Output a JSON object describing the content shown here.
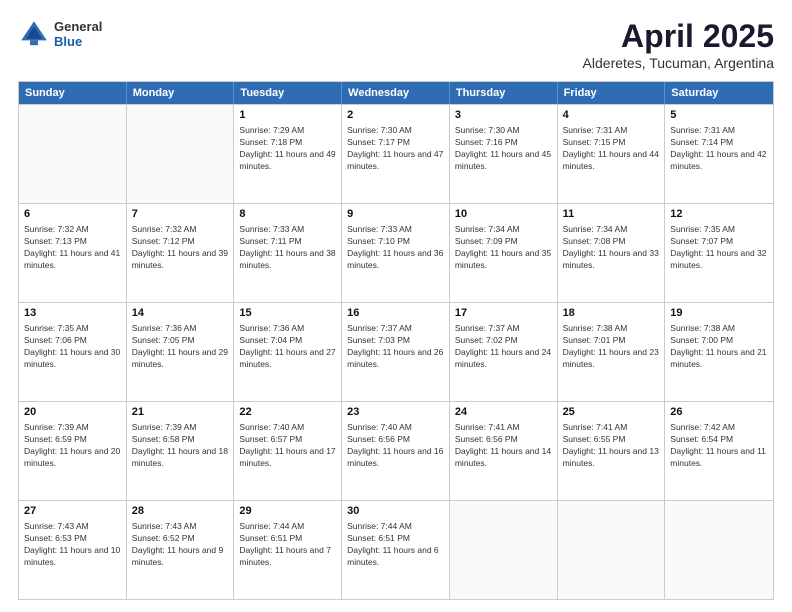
{
  "header": {
    "logo": {
      "general": "General",
      "blue": "Blue"
    },
    "title": "April 2025",
    "subtitle": "Alderetes, Tucuman, Argentina"
  },
  "weekdays": [
    "Sunday",
    "Monday",
    "Tuesday",
    "Wednesday",
    "Thursday",
    "Friday",
    "Saturday"
  ],
  "rows": [
    [
      {
        "day": "",
        "sunrise": "",
        "sunset": "",
        "daylight": ""
      },
      {
        "day": "",
        "sunrise": "",
        "sunset": "",
        "daylight": ""
      },
      {
        "day": "1",
        "sunrise": "Sunrise: 7:29 AM",
        "sunset": "Sunset: 7:18 PM",
        "daylight": "Daylight: 11 hours and 49 minutes."
      },
      {
        "day": "2",
        "sunrise": "Sunrise: 7:30 AM",
        "sunset": "Sunset: 7:17 PM",
        "daylight": "Daylight: 11 hours and 47 minutes."
      },
      {
        "day": "3",
        "sunrise": "Sunrise: 7:30 AM",
        "sunset": "Sunset: 7:16 PM",
        "daylight": "Daylight: 11 hours and 45 minutes."
      },
      {
        "day": "4",
        "sunrise": "Sunrise: 7:31 AM",
        "sunset": "Sunset: 7:15 PM",
        "daylight": "Daylight: 11 hours and 44 minutes."
      },
      {
        "day": "5",
        "sunrise": "Sunrise: 7:31 AM",
        "sunset": "Sunset: 7:14 PM",
        "daylight": "Daylight: 11 hours and 42 minutes."
      }
    ],
    [
      {
        "day": "6",
        "sunrise": "Sunrise: 7:32 AM",
        "sunset": "Sunset: 7:13 PM",
        "daylight": "Daylight: 11 hours and 41 minutes."
      },
      {
        "day": "7",
        "sunrise": "Sunrise: 7:32 AM",
        "sunset": "Sunset: 7:12 PM",
        "daylight": "Daylight: 11 hours and 39 minutes."
      },
      {
        "day": "8",
        "sunrise": "Sunrise: 7:33 AM",
        "sunset": "Sunset: 7:11 PM",
        "daylight": "Daylight: 11 hours and 38 minutes."
      },
      {
        "day": "9",
        "sunrise": "Sunrise: 7:33 AM",
        "sunset": "Sunset: 7:10 PM",
        "daylight": "Daylight: 11 hours and 36 minutes."
      },
      {
        "day": "10",
        "sunrise": "Sunrise: 7:34 AM",
        "sunset": "Sunset: 7:09 PM",
        "daylight": "Daylight: 11 hours and 35 minutes."
      },
      {
        "day": "11",
        "sunrise": "Sunrise: 7:34 AM",
        "sunset": "Sunset: 7:08 PM",
        "daylight": "Daylight: 11 hours and 33 minutes."
      },
      {
        "day": "12",
        "sunrise": "Sunrise: 7:35 AM",
        "sunset": "Sunset: 7:07 PM",
        "daylight": "Daylight: 11 hours and 32 minutes."
      }
    ],
    [
      {
        "day": "13",
        "sunrise": "Sunrise: 7:35 AM",
        "sunset": "Sunset: 7:06 PM",
        "daylight": "Daylight: 11 hours and 30 minutes."
      },
      {
        "day": "14",
        "sunrise": "Sunrise: 7:36 AM",
        "sunset": "Sunset: 7:05 PM",
        "daylight": "Daylight: 11 hours and 29 minutes."
      },
      {
        "day": "15",
        "sunrise": "Sunrise: 7:36 AM",
        "sunset": "Sunset: 7:04 PM",
        "daylight": "Daylight: 11 hours and 27 minutes."
      },
      {
        "day": "16",
        "sunrise": "Sunrise: 7:37 AM",
        "sunset": "Sunset: 7:03 PM",
        "daylight": "Daylight: 11 hours and 26 minutes."
      },
      {
        "day": "17",
        "sunrise": "Sunrise: 7:37 AM",
        "sunset": "Sunset: 7:02 PM",
        "daylight": "Daylight: 11 hours and 24 minutes."
      },
      {
        "day": "18",
        "sunrise": "Sunrise: 7:38 AM",
        "sunset": "Sunset: 7:01 PM",
        "daylight": "Daylight: 11 hours and 23 minutes."
      },
      {
        "day": "19",
        "sunrise": "Sunrise: 7:38 AM",
        "sunset": "Sunset: 7:00 PM",
        "daylight": "Daylight: 11 hours and 21 minutes."
      }
    ],
    [
      {
        "day": "20",
        "sunrise": "Sunrise: 7:39 AM",
        "sunset": "Sunset: 6:59 PM",
        "daylight": "Daylight: 11 hours and 20 minutes."
      },
      {
        "day": "21",
        "sunrise": "Sunrise: 7:39 AM",
        "sunset": "Sunset: 6:58 PM",
        "daylight": "Daylight: 11 hours and 18 minutes."
      },
      {
        "day": "22",
        "sunrise": "Sunrise: 7:40 AM",
        "sunset": "Sunset: 6:57 PM",
        "daylight": "Daylight: 11 hours and 17 minutes."
      },
      {
        "day": "23",
        "sunrise": "Sunrise: 7:40 AM",
        "sunset": "Sunset: 6:56 PM",
        "daylight": "Daylight: 11 hours and 16 minutes."
      },
      {
        "day": "24",
        "sunrise": "Sunrise: 7:41 AM",
        "sunset": "Sunset: 6:56 PM",
        "daylight": "Daylight: 11 hours and 14 minutes."
      },
      {
        "day": "25",
        "sunrise": "Sunrise: 7:41 AM",
        "sunset": "Sunset: 6:55 PM",
        "daylight": "Daylight: 11 hours and 13 minutes."
      },
      {
        "day": "26",
        "sunrise": "Sunrise: 7:42 AM",
        "sunset": "Sunset: 6:54 PM",
        "daylight": "Daylight: 11 hours and 11 minutes."
      }
    ],
    [
      {
        "day": "27",
        "sunrise": "Sunrise: 7:43 AM",
        "sunset": "Sunset: 6:53 PM",
        "daylight": "Daylight: 11 hours and 10 minutes."
      },
      {
        "day": "28",
        "sunrise": "Sunrise: 7:43 AM",
        "sunset": "Sunset: 6:52 PM",
        "daylight": "Daylight: 11 hours and 9 minutes."
      },
      {
        "day": "29",
        "sunrise": "Sunrise: 7:44 AM",
        "sunset": "Sunset: 6:51 PM",
        "daylight": "Daylight: 11 hours and 7 minutes."
      },
      {
        "day": "30",
        "sunrise": "Sunrise: 7:44 AM",
        "sunset": "Sunset: 6:51 PM",
        "daylight": "Daylight: 11 hours and 6 minutes."
      },
      {
        "day": "",
        "sunrise": "",
        "sunset": "",
        "daylight": ""
      },
      {
        "day": "",
        "sunrise": "",
        "sunset": "",
        "daylight": ""
      },
      {
        "day": "",
        "sunrise": "",
        "sunset": "",
        "daylight": ""
      }
    ]
  ]
}
